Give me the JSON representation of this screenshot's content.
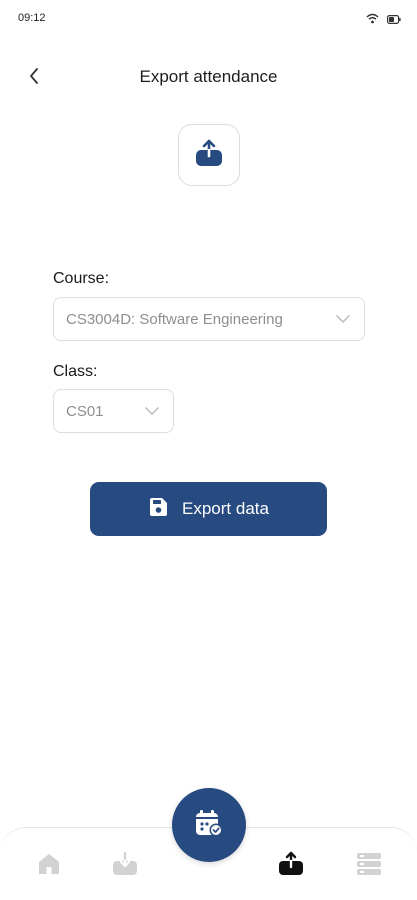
{
  "status_bar": {
    "time": "09:12",
    "icons": [
      "wifi-icon",
      "battery-icon"
    ]
  },
  "header": {
    "title": "Export attendance",
    "back_icon": "chevron-left-icon"
  },
  "hero": {
    "icon": "upload-icon"
  },
  "form": {
    "course": {
      "label": "Course:",
      "value": "CS3004D: Software Engineering"
    },
    "class": {
      "label": "Class:",
      "value": "CS01"
    }
  },
  "export_button": {
    "label": "Export data",
    "icon": "save-icon"
  },
  "bottom_nav": {
    "items": [
      "home-icon",
      "download-icon",
      "attendance-fab-icon",
      "upload-icon",
      "list-icon"
    ],
    "active": "upload-icon"
  },
  "colors": {
    "primary": "#274a80",
    "inactive_icon": "#cfcfcf",
    "border": "#dedede"
  }
}
